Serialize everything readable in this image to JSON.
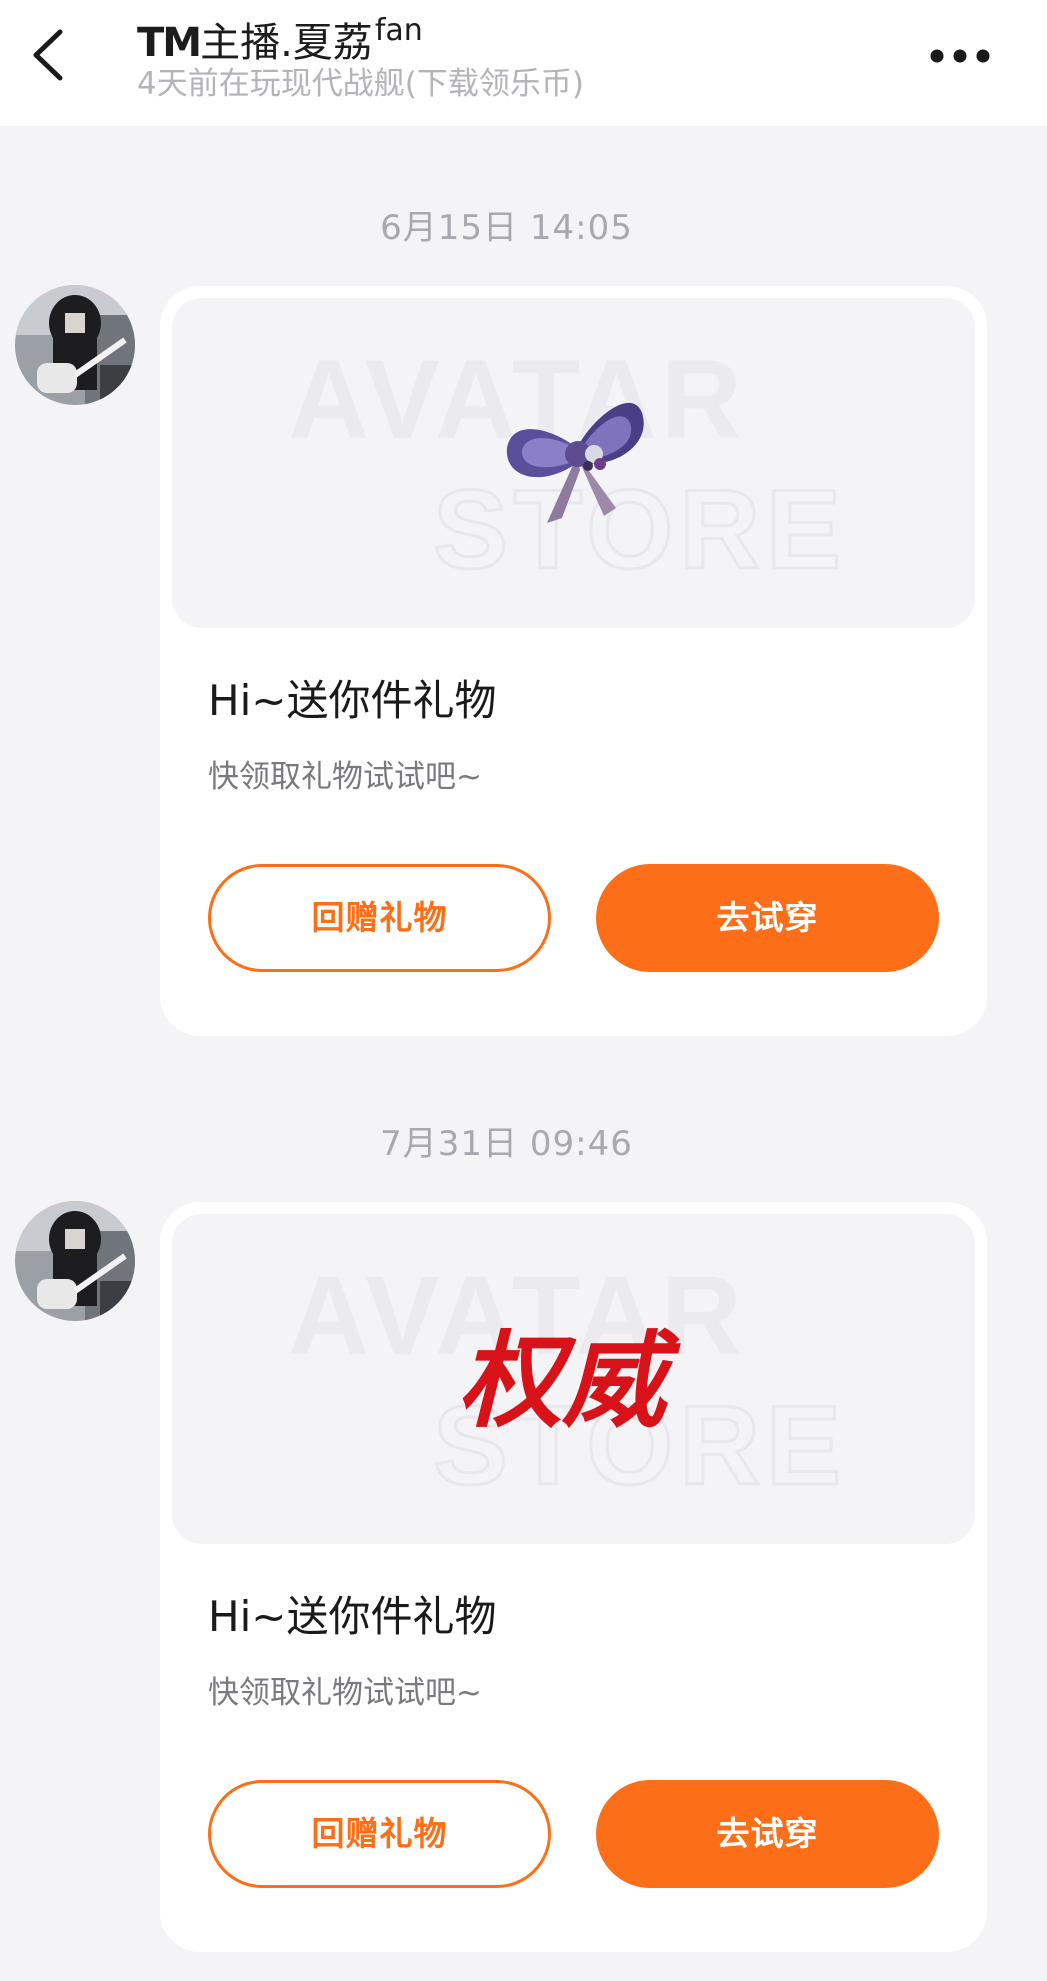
{
  "header": {
    "title_prefix": "TM",
    "title_main": "主播.夏荔",
    "title_sup": "fan",
    "status": "4天前在玩现代战舰(下载领乐币)"
  },
  "messages": [
    {
      "timestamp": "6月15日 14:05",
      "gift_icon": "purple-bow",
      "watermark_line1": "AVATAR",
      "watermark_line2": "STORE",
      "title": "Hi~送你件礼物",
      "subtitle": "快领取礼物试试吧~",
      "btn_return": "回赠礼物",
      "btn_try": "去试穿"
    },
    {
      "timestamp": "7月31日 09:46",
      "gift_icon": "authority-calligraphy",
      "gift_text": "权威",
      "watermark_line1": "AVATAR",
      "watermark_line2": "STORE",
      "title": "Hi~送你件礼物",
      "subtitle": "快领取礼物试试吧~",
      "btn_return": "回赠礼物",
      "btn_try": "去试穿"
    }
  ],
  "colors": {
    "accent": "#fc6f18",
    "background": "#f4f4f7",
    "calligraphy_red": "#d71219"
  }
}
